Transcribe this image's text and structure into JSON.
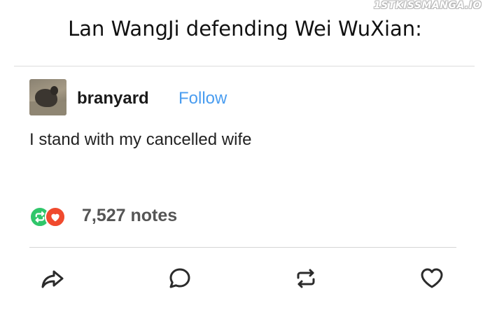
{
  "watermark": "1STKISSMANGA.IO",
  "caption": "Lan WangJi defending Wei WuXian:",
  "post": {
    "username": "branyard",
    "follow_label": "Follow",
    "body": "I stand with my cancelled wife",
    "notes": "7,527 notes"
  },
  "colors": {
    "follow_blue": "#4a9df0",
    "reblog_green": "#2fc66a",
    "like_red": "#f04a2e",
    "icon_dark": "#2b2b2b",
    "notes_gray": "#555555"
  },
  "icons": {
    "note_badges": [
      "reblog-icon",
      "heart-icon"
    ],
    "actions": [
      "share-icon",
      "reply-icon",
      "reblog-icon",
      "heart-icon"
    ]
  }
}
